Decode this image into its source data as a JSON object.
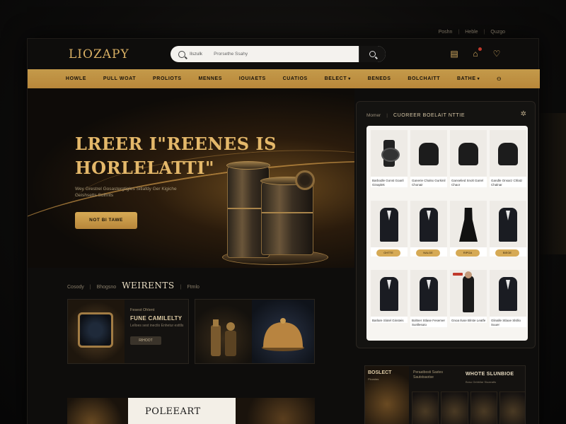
{
  "util_links": [
    "Poshn",
    "Heble",
    "Quzgo"
  ],
  "header": {
    "logo": "LIOZAPY",
    "search": {
      "scope": "Ilszulk",
      "placeholder": "Prorsethe Ssahy"
    }
  },
  "nav": [
    "HOWLE",
    "PULL WOAT",
    "PROLIOTS",
    "MENNES",
    "IOUIAETS",
    "CUATIOS",
    "BELECT",
    "BENEDS",
    "BOLCHAITT",
    "BATHE"
  ],
  "hero": {
    "title_line1": "LREER I\"REENES IS",
    "title_line2": "HORLELATTI\"",
    "subtitle": "Wey Grestrel Gosastergtigles Sitlafdy Ger Kigiche Geishsetts Sulhrits",
    "cta": "NOT BI TAWE"
  },
  "section": {
    "tabs": [
      "Cosody",
      "Bhogsno"
    ],
    "active": "WEIRENTS",
    "extra": "Ftmlo"
  },
  "card1": {
    "brand": "Fesest Ohlent",
    "name": "FUNE CAMILELTY",
    "desc": "Lelloes sest inectlo Enhetur esttlls",
    "button": "RIHOOT"
  },
  "banner": {
    "title": "POLEEART"
  },
  "panel": {
    "crumb": "Momer",
    "title": "CUOREER BOELAIT NTTIE",
    "products": [
      {
        "name": "Barbodle Gonst Goaril Ginaplek",
        "shape": "watch"
      },
      {
        "name": "Ganerie Chalsx Gurkinil Chonair",
        "shape": "chair"
      },
      {
        "name": "Ganselied Snolt Gariel Chaor",
        "shape": "chair"
      },
      {
        "name": "Gandle Onsarz Chlatz Chalnar",
        "shape": "chair"
      },
      {
        "name": "GHTTE",
        "shape": "suit",
        "pill": true
      },
      {
        "name": "NALGE",
        "shape": "suit",
        "pill": true
      },
      {
        "name": "RIPGA",
        "shape": "dress",
        "pill": true
      },
      {
        "name": "BIEGE",
        "shape": "suit",
        "pill": true
      },
      {
        "name": "Barlare Slotel Ginsteis",
        "shape": "suit"
      },
      {
        "name": "Boltner Stlase Fesemer Sunllesuto",
        "shape": "suit"
      },
      {
        "name": "Gnoa Iluse Blrste Leatfe",
        "shape": "person",
        "sale": true
      },
      {
        "name": "Glinalle Stlaoe Slsllio Suuer",
        "shape": "suit"
      }
    ]
  },
  "bottom_right": {
    "label": "BOSLECT",
    "label_sub": "Ploostas",
    "text": "Peraatbosti Sastes Sautstsaotse",
    "title": "WHOTE SLUNBIOE",
    "subtitle": "Bosu Gebbliar Siuaeatts"
  },
  "colors": {
    "accent": "#d6aa55",
    "nav_bg": "#c49a4a",
    "bg": "#0e0d0c"
  },
  "icons": [
    "search-icon",
    "clipboard-icon",
    "cart-icon",
    "heart-icon"
  ]
}
